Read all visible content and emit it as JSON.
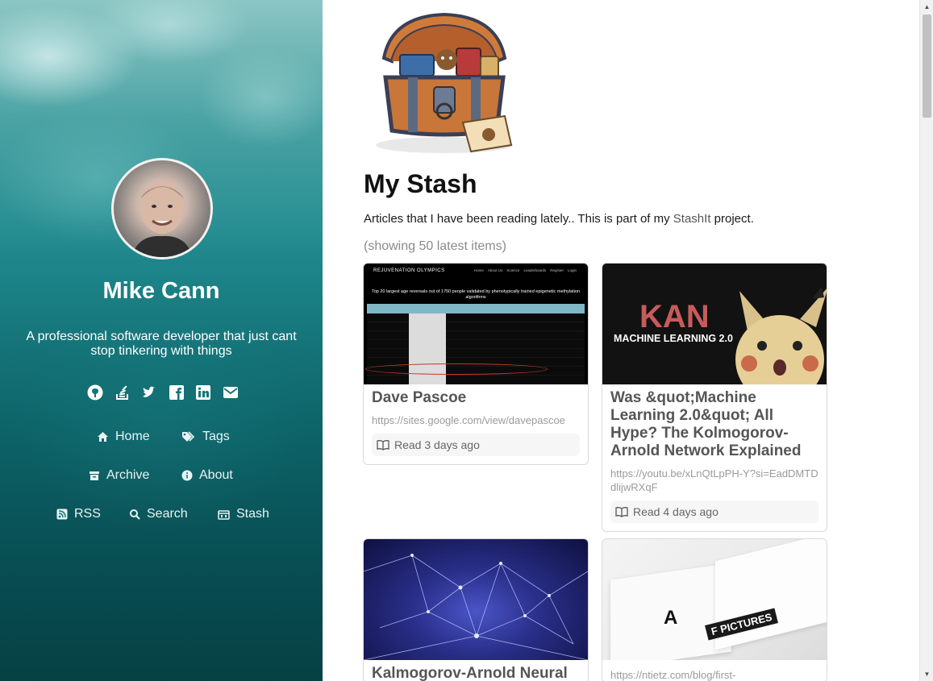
{
  "sidebar": {
    "author_name": "Mike Cann",
    "bio": "A professional software developer that just cant stop tinkering with things",
    "socials": [
      "github-icon",
      "stackoverflow-icon",
      "twitter-icon",
      "facebook-icon",
      "linkedin-icon",
      "email-icon"
    ],
    "nav": {
      "home": "Home",
      "tags": "Tags",
      "archive": "Archive",
      "about": "About",
      "rss": "RSS",
      "search": "Search",
      "stash": "Stash"
    }
  },
  "main": {
    "title": "My Stash",
    "intro_before": "Articles that I have been reading lately.. This is part of my ",
    "intro_link": "StashIt",
    "intro_after": " project.",
    "showing": "(showing 50 latest items)",
    "cards": [
      {
        "title": "Dave Pascoe",
        "url": "https://sites.google.com/view/davepascoe",
        "read": "Read 3 days ago",
        "thumb": {
          "brand": "REJUVENATION OLYMPICS",
          "headline": "Top 20 largest age reversals out of 1750 people validated by phenotypically trained epigenetic methylation algorithms",
          "menu": [
            "Home",
            "About Us",
            "Science",
            "Leaderboards",
            "Register",
            "Login"
          ]
        }
      },
      {
        "title": "Was &quot;Machine Learning 2.0&quot; All Hype? The Kolmogorov-Arnold Network Explained",
        "url": "https://youtu.be/xLnQtLpPH-Y?si=EadDMTDdlijwRXqF",
        "read": "Read 4 days ago",
        "thumb": {
          "big": "KAN",
          "sub": "MACHINE LEARNING 2.0"
        }
      },
      {
        "title": "Kalmogorov-Arnold Neural",
        "url": "",
        "read": ""
      },
      {
        "title": "",
        "url": "https://ntietz.com/blog/first-",
        "read": "",
        "thumb": {
          "letter": "A",
          "words": "F PICTURES"
        }
      }
    ]
  },
  "colors": {
    "sidebar_teal": "#0f6e73",
    "card_border": "#d9d9d9",
    "muted": "#9a9a9a"
  }
}
